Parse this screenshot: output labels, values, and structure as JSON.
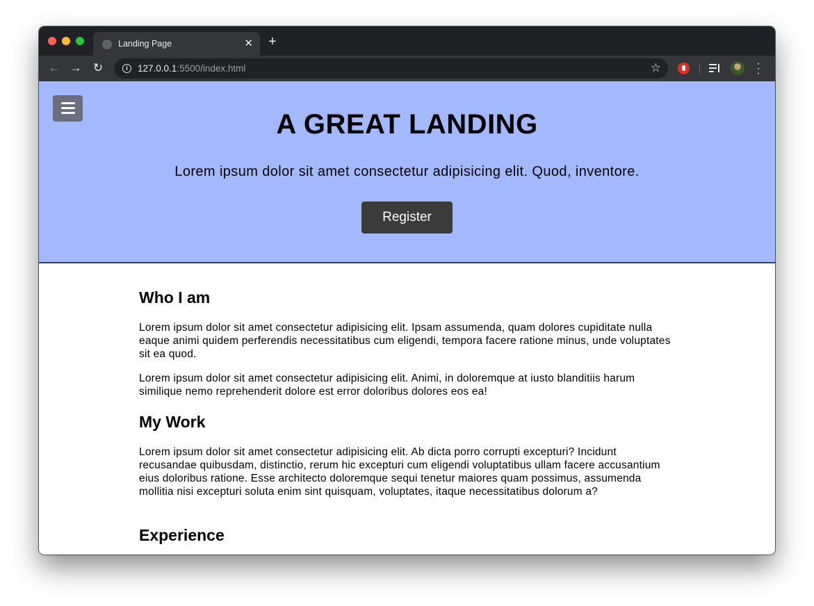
{
  "browser": {
    "tab_title": "Landing Page",
    "tab_close": "✕",
    "new_tab": "+",
    "url_host": "127.0.0.1",
    "url_rest": ":5500/index.html",
    "icons": [
      "back-arrow-icon",
      "forward-arrow-icon",
      "reload-icon",
      "info-icon",
      "star-icon",
      "extension-icon",
      "media-control-icon",
      "profile-avatar",
      "menu-kebab-icon"
    ]
  },
  "hero": {
    "title": "A GREAT LANDING",
    "subtitle": "Lorem ipsum dolor sit amet consectetur adipisicing elit. Quod, inventore.",
    "button": "Register",
    "background": "#a3b8fd"
  },
  "sections": {
    "who": {
      "heading": "Who I am",
      "p1": "Lorem ipsum dolor sit amet consectetur adipisicing elit. Ipsam assumenda, quam dolores cupiditate nulla eaque animi quidem perferendis necessitatibus cum eligendi, tempora facere ratione minus, unde voluptates sit ea quod.",
      "p2": "Lorem ipsum dolor sit amet consectetur adipisicing elit. Animi, in doloremque at iusto blanditiis harum similique nemo reprehenderit dolore est error doloribus dolores eos ea!"
    },
    "work": {
      "heading": "My Work",
      "p1": "Lorem ipsum dolor sit amet consectetur adipisicing elit. Ab dicta porro corrupti excepturi? Incidunt recusandae quibusdam, distinctio, rerum hic excepturi cum eligendi voluptatibus ullam facere accusantium eius doloribus ratione. Esse architecto doloremque sequi tenetur maiores quam possimus, assumenda mollitia nisi excepturi soluta enim sint quisquam, voluptates, itaque necessitatibus dolorum a?"
    },
    "experience": {
      "heading": "Experience"
    }
  }
}
